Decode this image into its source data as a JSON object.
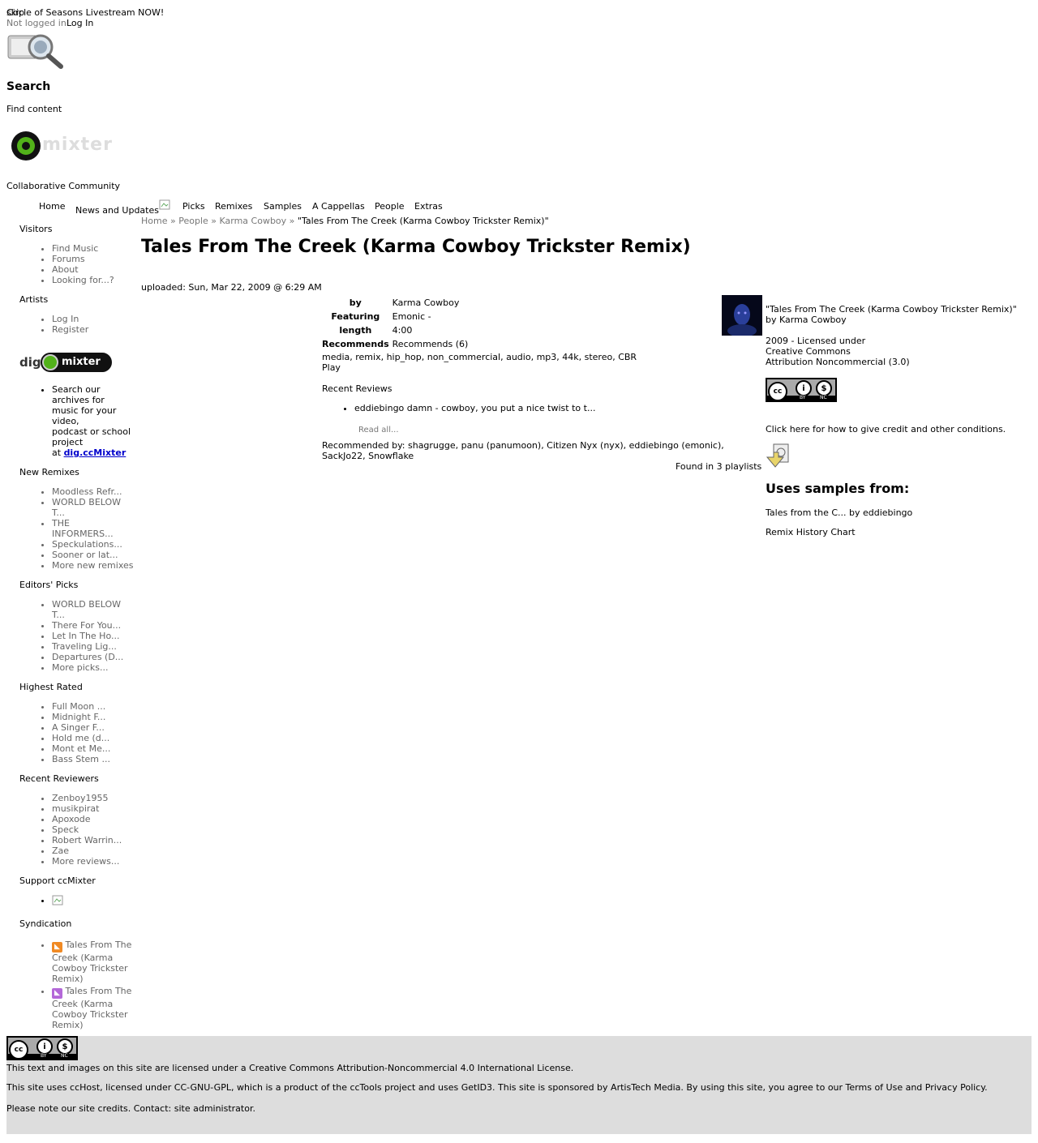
{
  "top": {
    "skip": "skip",
    "banner": "Circle of Seasons Livestream NOW!",
    "login_status": "Not logged in",
    "login_link": "Log In"
  },
  "search": {
    "title": "Search",
    "subtitle": "Find content"
  },
  "logo": {
    "tagline": "Collaborative Community",
    "wordmark": "mixter"
  },
  "nav": {
    "items": [
      "Home",
      "News and Updates",
      "Picks",
      "Remixes",
      "Samples",
      "A Cappellas",
      "People",
      "Extras"
    ]
  },
  "breadcrumb": {
    "home": "Home",
    "sep": "»",
    "people": "People",
    "artist": "Karma Cowboy",
    "current": "\"Tales From The Creek (Karma Cowboy Trickster Remix)\""
  },
  "page": {
    "title": "Tales From The Creek (Karma Cowboy Trickster Remix)",
    "uploaded": "uploaded: Sun, Mar 22, 2009 @ 6:29 AM"
  },
  "meta": {
    "by_label": "by",
    "by_value": "Karma Cowboy",
    "featuring_label": "Featuring",
    "featuring_value": "Emonic -",
    "length_label": "length",
    "length_value": "4:00",
    "recommends_label": "Recommends",
    "recommends_value": "Recommends (6)",
    "tags": "media, remix, hip_hop, non_commercial, audio, mp3, 44k, stereo, CBR",
    "play": "Play"
  },
  "reviews": {
    "heading": "Recent Reviews",
    "items": [
      "eddiebingo damn - cowboy, you put a nice twist to t..."
    ],
    "read_all": "Read all...",
    "recommended_by": "Recommended by: shagrugge, panu (panumoon), Citizen Nyx (nyx), eddiebingo (emonic), SackJo22, Snowflake",
    "playlists": "Found in 3 playlists"
  },
  "license": {
    "work": "\"Tales From The Creek (Karma Cowboy Trickster Remix)\"",
    "by_line": "by Karma Cowboy",
    "year_line": "2009 - Licensed under",
    "cc_line": "Creative Commons",
    "type_line": "Attribution Noncommercial (3.0)",
    "badge_by": "BY",
    "badge_nc": "NC",
    "credit_link": "Click here for how to give credit and other conditions.",
    "samples_heading": "Uses samples from:",
    "sample_item": "Tales from the C... by eddiebingo",
    "history": "Remix History Chart"
  },
  "sidebar": {
    "visitors": {
      "heading": "Visitors",
      "items": [
        "Find Music",
        "Forums",
        "About",
        "Looking for...?"
      ]
    },
    "artists": {
      "heading": "Artists",
      "items": [
        "Log In",
        "Register"
      ]
    },
    "dig": {
      "logo_left": "dig",
      "logo_right": "mixter",
      "text_lines": [
        "Search our",
        "archives for",
        "music for your",
        "video,",
        "podcast or school",
        "project"
      ],
      "at": "at ",
      "link": "dig.ccMixter"
    },
    "new_remixes": {
      "heading": "New Remixes",
      "items": [
        "Moodless Refr...",
        "WORLD BELOW T...",
        "THE INFORMERS...",
        "Speckulations...",
        "Sooner or lat...",
        "More new remixes"
      ]
    },
    "editors_picks": {
      "heading": "Editors' Picks",
      "items": [
        "WORLD BELOW T...",
        "There For You...",
        "Let In The Ho...",
        "Traveling Lig...",
        "Departures (D...",
        "More picks..."
      ]
    },
    "highest_rated": {
      "heading": "Highest Rated",
      "items": [
        "Full Moon ...",
        "Midnight F...",
        "A Singer F...",
        "Hold me (d...",
        "Mont et Me...",
        "Bass Stem ..."
      ]
    },
    "recent_reviewers": {
      "heading": "Recent Reviewers",
      "items": [
        "Zenboy1955",
        "musikpirat",
        "Apoxode",
        "Speck",
        "Robert Warrin...",
        "Zae",
        "More reviews..."
      ]
    },
    "support": {
      "heading": "Support ccMixter"
    },
    "syndication": {
      "heading": "Syndication",
      "items": [
        "Tales From The Creek (Karma Cowboy Trickster Remix)",
        "Tales From The Creek (Karma Cowboy Trickster Remix)"
      ]
    }
  },
  "footer": {
    "line1": "This text and images on this site are licensed under a Creative Commons Attribution-Noncommercial 4.0 International License.",
    "line2": "This site uses ccHost, licensed under CC-GNU-GPL, which is a product of the ccTools project and uses GetID3. This site is sponsored by ArtisTech Media. By using this site, you agree to our Terms of Use and Privacy Policy.",
    "line3": "Please note our site credits. Contact: site administrator."
  },
  "colors": {
    "rss": "#f08a24",
    "podcast": "#b468d8",
    "logo_green": "#52b21a",
    "footer_bg": "#dddddd"
  }
}
